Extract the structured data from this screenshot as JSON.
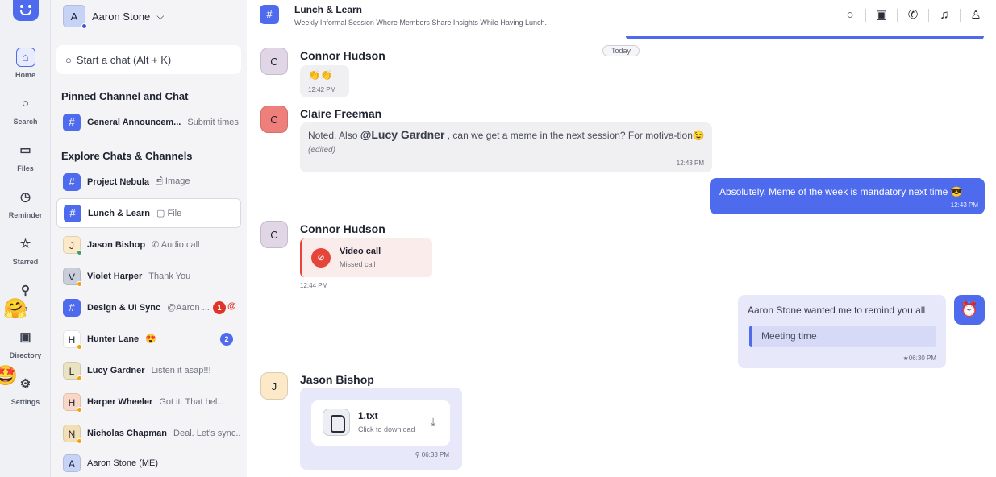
{
  "rail": {
    "items": [
      {
        "label": "Home",
        "icon": "⌂"
      },
      {
        "label": "Search",
        "icon": "○"
      },
      {
        "label": "Files",
        "icon": "▭"
      },
      {
        "label": "Reminder",
        "icon": "◷"
      },
      {
        "label": "Starred",
        "icon": "☆"
      },
      {
        "label": "n",
        "icon": "⚲"
      },
      {
        "label": "Directory",
        "icon": "▣"
      },
      {
        "label": "Settings",
        "icon": "⚙"
      }
    ],
    "emoji_1": "🤗",
    "emoji_2": "🤩"
  },
  "sidebar": {
    "user": {
      "initial": "A",
      "name": "Aaron Stone",
      "caret": "⌵"
    },
    "search_placeholder": "Start a chat (Alt + K)",
    "pinned_title": "Pinned Channel and Chat",
    "explore_title": "Explore Chats & Channels",
    "pinned": [
      {
        "name": "General Announcem...",
        "sub": "Submit times"
      }
    ],
    "chats": [
      {
        "initial": "#",
        "name": "Project Nebula",
        "sub": "🖻 Image"
      },
      {
        "initial": "#",
        "name": "Lunch & Learn",
        "sub": "▢ File"
      },
      {
        "initial": "J",
        "name": "Jason Bishop",
        "sub": "✆ Audio call"
      },
      {
        "initial": "V",
        "name": "Violet Harper",
        "sub": "Thank You"
      },
      {
        "initial": "#",
        "name": "Design & UI Sync",
        "sub": "@Aaron ...",
        "badge": "1",
        "mention": "@"
      },
      {
        "initial": "H",
        "name": "Hunter Lane",
        "sub": "😍",
        "badge": "2"
      },
      {
        "initial": "L",
        "name": "Lucy Gardner",
        "sub": "Listen it asap!!!"
      },
      {
        "initial": "H",
        "name": "Harper Wheeler",
        "sub": "Got it. That hel..."
      },
      {
        "initial": "N",
        "name": "Nicholas Chapman",
        "sub": "Deal. Let's sync..."
      },
      {
        "initial": "A",
        "name": "Aaron Stone (ME)",
        "sub": ""
      }
    ]
  },
  "header": {
    "title": "Lunch & Learn",
    "subtitle": "Weekly Informal Session Where Members Share Insights While Having Lunch.",
    "hash": "#"
  },
  "conversation": {
    "day_label": "Today",
    "msg1": {
      "initial": "C",
      "sender": "Connor Hudson",
      "text": "👏👏",
      "time": "12:42 PM"
    },
    "msg2": {
      "initial": "C",
      "sender": "Claire Freeman",
      "prefix": "Noted. Also",
      "mention": "@Lucy Gardner",
      "suffix": ", can we get a meme in the next session? For motiva-tion😉",
      "edited": "(edited)",
      "time": "12:43 PM"
    },
    "msg3": {
      "text": "Absolutely. Meme of the week is mandatory next time 😎",
      "time": "12:43 PM"
    },
    "msg4": {
      "initial": "C",
      "sender": "Connor Hudson",
      "call_title": "Video call",
      "call_sub": "Missed call",
      "time": "12:44 PM"
    },
    "msg5": {
      "text": "Aaron Stone wanted me to remind you all",
      "meeting": "Meeting time",
      "time": "★06:30 PM"
    },
    "msg6": {
      "initial": "J",
      "sender": "Jason Bishop",
      "file_name": "1.txt",
      "file_sub": "Click to download",
      "time": "⚲ 06:33 PM"
    }
  }
}
